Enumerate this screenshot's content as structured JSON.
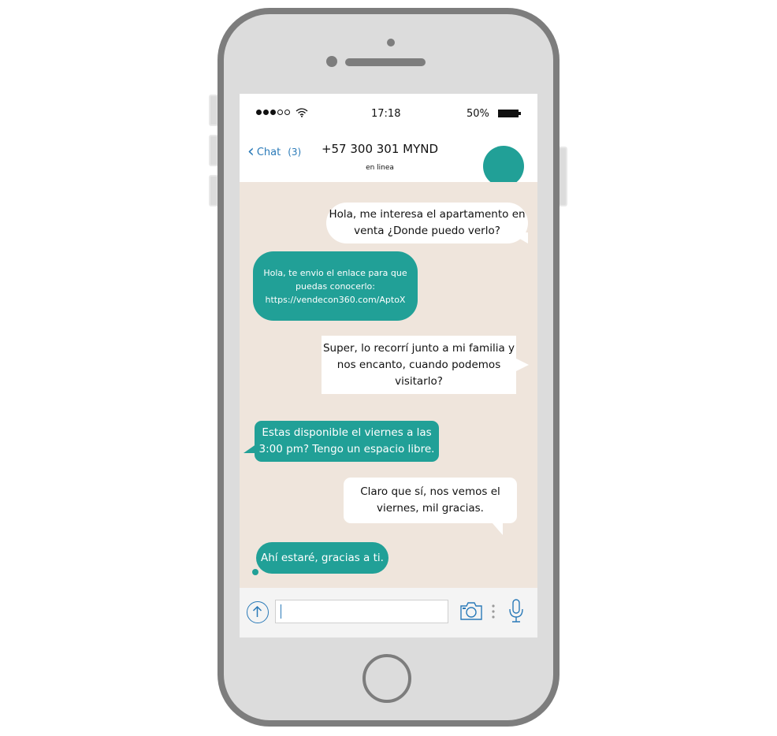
{
  "status_bar": {
    "time": "17:18",
    "battery_percent": "50%",
    "signal_bars_filled": 3,
    "signal_bars_total": 5
  },
  "header": {
    "back_label": "Chat",
    "unread_count": "(3)",
    "contact_name": "+57 300 301 MYND",
    "contact_status": "en linea"
  },
  "colors": {
    "accent": "#21a097",
    "link_blue": "#2a7ab8",
    "chat_background": "#efe5dc",
    "phone_frame": "#7d7d7d"
  },
  "messages": [
    {
      "direction": "outgoing",
      "text": "Hola, me interesa el apartamento en venta ¿Donde puedo verlo?"
    },
    {
      "direction": "incoming",
      "text": "Hola, te envio el enlace para que puedas conocerlo: https://vendecon360.com/AptoX"
    },
    {
      "direction": "outgoing",
      "text": "Super, lo recorrí junto a mi familia y nos encanto, cuando podemos visitarlo?"
    },
    {
      "direction": "incoming",
      "text": "Estas disponible el viernes a las 3:00 pm? Tengo un espacio libre."
    },
    {
      "direction": "outgoing",
      "text": "Claro que sí, nos vemos el viernes, mil gracias."
    },
    {
      "direction": "incoming",
      "text": "Ahí estaré, gracias a ti."
    }
  ],
  "input_bar": {
    "message_value": "",
    "icons": [
      "upload-arrow-icon",
      "camera-icon",
      "more-vertical-icon",
      "microphone-icon"
    ]
  }
}
